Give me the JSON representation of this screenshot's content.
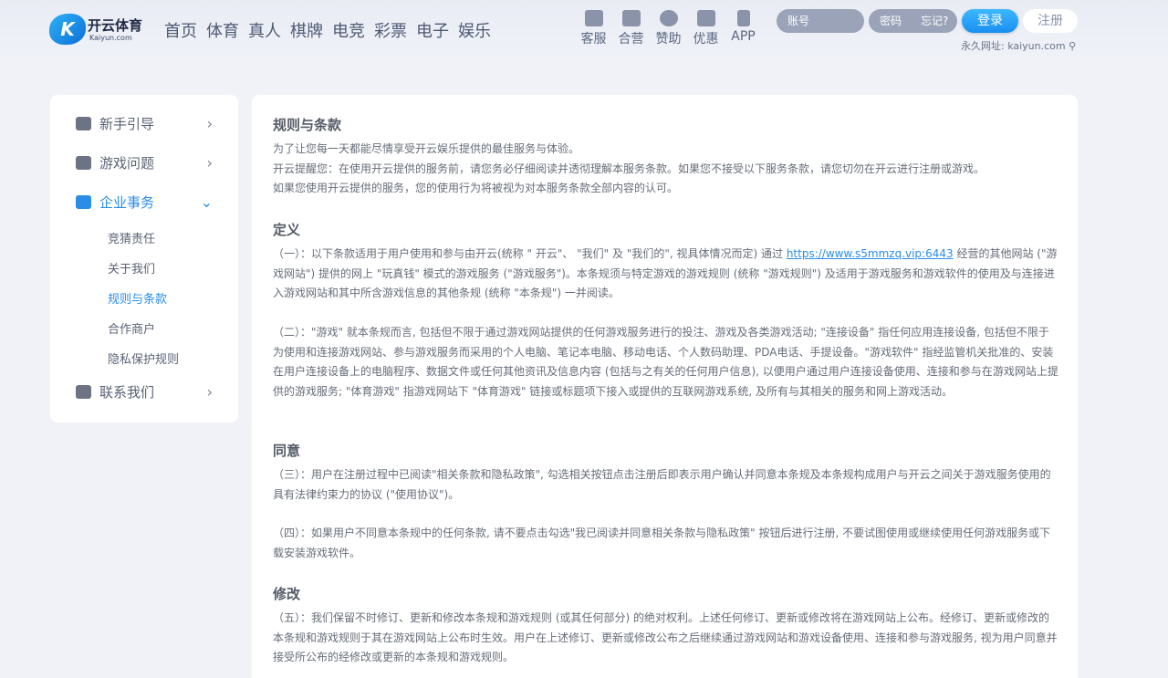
{
  "logo": {
    "mark": "K",
    "name": "开云体育",
    "sub": "Kaiyun.com"
  },
  "nav": [
    "首页",
    "体育",
    "真人",
    "棋牌",
    "电竞",
    "彩票",
    "电子",
    "娱乐"
  ],
  "quick": [
    {
      "label": "客服",
      "icon": "chat-icon"
    },
    {
      "label": "合营",
      "icon": "grid-icon"
    },
    {
      "label": "赞助",
      "icon": "diamond-icon"
    },
    {
      "label": "优惠",
      "icon": "gift-icon"
    },
    {
      "label": "APP",
      "icon": "phone-icon"
    }
  ],
  "login": {
    "account_placeholder": "账号",
    "password_placeholder": "密码",
    "forgot": "忘记?",
    "login_btn": "登录",
    "register_btn": "注册",
    "permanent": "永久网址: kaiyun.com"
  },
  "sidebar": {
    "items": [
      {
        "label": "新手引导",
        "chevron": "›"
      },
      {
        "label": "游戏问题",
        "chevron": "›"
      },
      {
        "label": "企业事务",
        "chevron": "⌄"
      },
      {
        "label": "联系我们",
        "chevron": "›"
      }
    ],
    "subs": [
      "竞猜责任",
      "关于我们",
      "规则与条款",
      "合作商户",
      "隐私保护规则"
    ]
  },
  "content": {
    "title": "规则与条款",
    "intro1": "为了让您每一天都能尽情享受开云娱乐提供的最佳服务与体验。",
    "intro2": "开云提醒您：在使用开云提供的服务前，请您务必仔细阅读并透彻理解本服务条款。如果您不接受以下服务条款，请您切勿在开云进行注册或游戏。",
    "intro3": "如果您使用开云提供的服务，您的使用行为将被视为对本服务条款全部内容的认可。",
    "h_def": "定义",
    "p1_a": "（一）：以下条款适用于用户使用和参与由开云(统称 \" 开云\"、 \"我们\" 及 \"我们的\", 视具体情况而定) 通过 ",
    "p1_link": "https://www.s5mmzq.vip:6443",
    "p1_b": " 经营的其他网站 (\"游戏网站\") 提供的网上 \"玩真钱\" 模式的游戏服务 (\"游戏服务\")。本条规须与特定游戏的游戏规则 (统称 \"游戏规则\") 及适用于游戏服务和游戏软件的使用及与连接进入游戏网站和其中所含游戏信息的其他条规 (统称 \"本条规\") 一并阅读。",
    "p2": "（二）：\"游戏\" 就本条规而言, 包括但不限于通过游戏网站提供的任何游戏服务进行的投注、游戏及各类游戏活动; \"连接设备\" 指任何应用连接设备, 包括但不限于为使用和连接游戏网站、参与游戏服务而采用的个人电脑、笔记本电脑、移动电话、个人数码助理、PDA电话、手提设备。\"游戏软件\" 指经监管机关批准的、安装在用户连接设备上的电脑程序、数据文件或任何其他资讯及信息内容 (包括与之有关的任何用户信息), 以便用户通过用户连接设备使用、连接和参与在游戏网站上提供的游戏服务; \"体育游戏\" 指游戏网站下 \"体育游戏\" 链接或标题项下接入或提供的互联网游戏系统, 及所有与其相关的服务和网上游戏活动。",
    "h_agree": "同意",
    "p3": "（三）：用户在注册过程中已阅读\"相关条款和隐私政策\", 勾选相关按钮点击注册后即表示用户确认并同意本条规及本条规构成用户与开云之间关于游戏服务使用的具有法律约束力的协议 (\"使用协议\")。",
    "p4": "（四）：如果用户不同意本条规中的任何条款, 请不要点击勾选\"我已阅读并同意相关条款与隐私政策\" 按钮后进行注册, 不要试图使用或继续使用任何游戏服务或下载安装游戏软件。",
    "h_mod": "修改",
    "p5": "（五）：我们保留不时修订、更新和修改本条规和游戏规则 (或其任何部分) 的绝对权利。上述任何修订、更新或修改将在游戏网站上公布。经修订、更新或修改的本条规和游戏规则于其在游戏网站上公布时生效。用户在上述修订、更新或修改公布之后继续通过游戏网站和游戏设备使用、连接和参与游戏服务, 视为用户同意并接受所公布的经修改或更新的本条规和游戏规则。"
  }
}
